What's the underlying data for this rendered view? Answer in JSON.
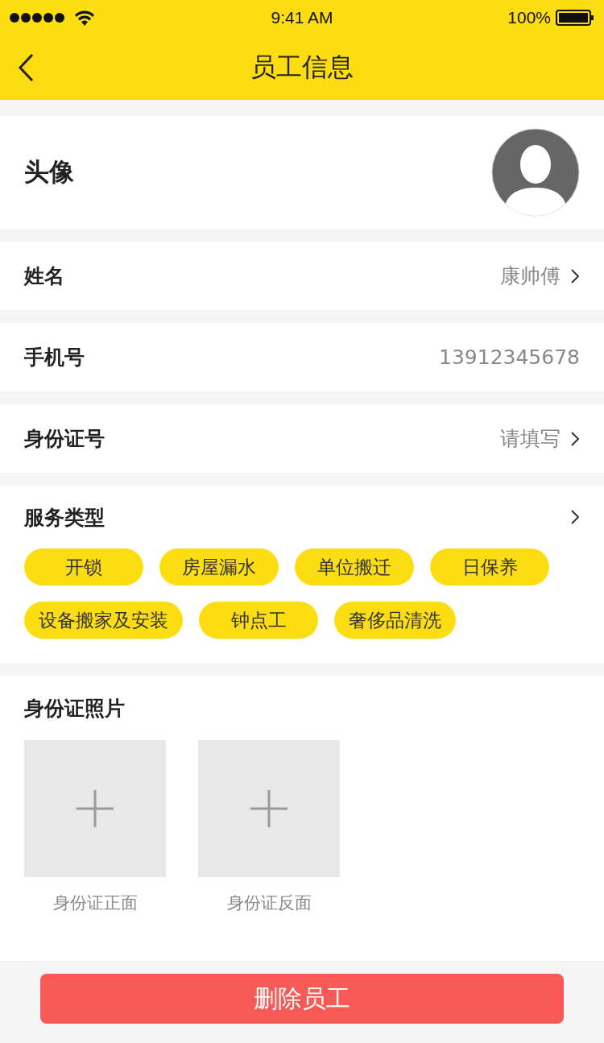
{
  "status_bar": {
    "time": "9:41 AM",
    "battery": "100%"
  },
  "nav": {
    "title": "员工信息"
  },
  "avatar_row": {
    "label": "头像"
  },
  "rows": [
    {
      "label": "姓名",
      "value": "康帅傅",
      "chevron": true
    },
    {
      "label": "手机号",
      "value": "13912345678",
      "chevron": false
    },
    {
      "label": "身份证号",
      "value": "请填写",
      "chevron": true
    }
  ],
  "services": {
    "label": "服务类型",
    "chevron": true,
    "tags": [
      "开锁",
      "房屋漏水",
      "单位搬迁",
      "日保养",
      "设备搬家及安装",
      "钟点工",
      "奢侈品清洗"
    ]
  },
  "id_photos": {
    "label": "身份证照片",
    "slots": [
      "身份证正面",
      "身份证反面"
    ]
  },
  "delete_button": "删除员工"
}
